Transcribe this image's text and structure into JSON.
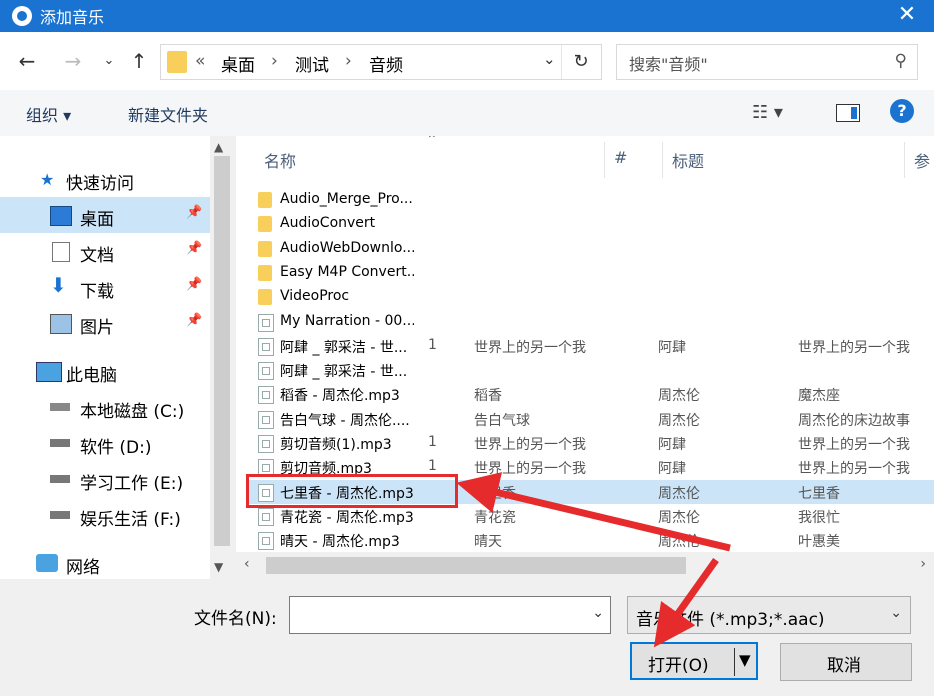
{
  "window": {
    "title": "添加音乐",
    "close_icon": "close-icon"
  },
  "nav": {
    "breadcrumb": [
      "桌面",
      "测试",
      "音频"
    ],
    "overflow": "«",
    "search_placeholder": "搜索\"音频\""
  },
  "toolbar": {
    "organize": "组织 ▾",
    "new_folder": "新建文件夹",
    "help": "?"
  },
  "sidebar": {
    "items": [
      {
        "label": "快速访问",
        "icon": "star-icon",
        "pinned": false
      },
      {
        "label": "桌面",
        "icon": "desktop-icon",
        "pinned": true
      },
      {
        "label": "文档",
        "icon": "document-icon",
        "pinned": true
      },
      {
        "label": "下载",
        "icon": "download-icon",
        "pinned": true
      },
      {
        "label": "图片",
        "icon": "pictures-icon",
        "pinned": true
      },
      {
        "label": "此电脑",
        "icon": "computer-icon",
        "pinned": false
      },
      {
        "label": "本地磁盘 (C:)",
        "icon": "drive-icon",
        "pinned": false
      },
      {
        "label": "软件 (D:)",
        "icon": "drive-icon",
        "pinned": false
      },
      {
        "label": "学习工作 (E:)",
        "icon": "drive-icon",
        "pinned": false
      },
      {
        "label": "娱乐生活 (F:)",
        "icon": "drive-icon",
        "pinned": false
      },
      {
        "label": "网络",
        "icon": "network-icon",
        "pinned": false
      }
    ],
    "selected_index": 1
  },
  "filelist": {
    "columns": [
      "名称",
      "#",
      "标题",
      "参"
    ],
    "rows": [
      {
        "name": "Audio_Merge_Pro...",
        "num": "",
        "title": "",
        "artist": "",
        "album": "",
        "kind": "folder"
      },
      {
        "name": "AudioConvert",
        "num": "",
        "title": "",
        "artist": "",
        "album": "",
        "kind": "folder"
      },
      {
        "name": "AudioWebDownlo...",
        "num": "",
        "title": "",
        "artist": "",
        "album": "",
        "kind": "folder"
      },
      {
        "name": "Easy M4P Convert...",
        "num": "",
        "title": "",
        "artist": "",
        "album": "",
        "kind": "folder"
      },
      {
        "name": "VideoProc",
        "num": "",
        "title": "",
        "artist": "",
        "album": "",
        "kind": "folder"
      },
      {
        "name": "My Narration - 00...",
        "num": "",
        "title": "",
        "artist": "",
        "album": "",
        "kind": "file"
      },
      {
        "name": "阿肆 _ 郭采洁 - 世...",
        "num": "1",
        "title": "世界上的另一个我",
        "artist": "阿肆",
        "album": "世界上的另一个我",
        "kind": "file"
      },
      {
        "name": "阿肆 _ 郭采洁 - 世...",
        "num": "",
        "title": "",
        "artist": "",
        "album": "",
        "kind": "file"
      },
      {
        "name": "稻香 - 周杰伦.mp3",
        "num": "",
        "title": "稻香",
        "artist": "周杰伦",
        "album": "魔杰座",
        "kind": "file"
      },
      {
        "name": "告白气球 - 周杰伦....",
        "num": "",
        "title": "告白气球",
        "artist": "周杰伦",
        "album": "周杰伦的床边故事",
        "kind": "file"
      },
      {
        "name": "剪切音频(1).mp3",
        "num": "1",
        "title": "世界上的另一个我",
        "artist": "阿肆",
        "album": "世界上的另一个我",
        "kind": "file"
      },
      {
        "name": "剪切音频.mp3",
        "num": "1",
        "title": "世界上的另一个我",
        "artist": "阿肆",
        "album": "世界上的另一个我",
        "kind": "file"
      },
      {
        "name": "七里香 - 周杰伦.mp3",
        "num": "",
        "title": "七里香",
        "artist": "周杰伦",
        "album": "七里香",
        "kind": "file"
      },
      {
        "name": "青花瓷 - 周杰伦.mp3",
        "num": "",
        "title": "青花瓷",
        "artist": "周杰伦",
        "album": "我很忙",
        "kind": "file"
      },
      {
        "name": "晴天 - 周杰伦.mp3",
        "num": "",
        "title": "晴天",
        "artist": "周杰伦",
        "album": "叶惠美",
        "kind": "file"
      }
    ],
    "selected_index": 12
  },
  "footer": {
    "filename_label": "文件名(N):",
    "filename_value": "",
    "filetype": "音乐文件 (*.mp3;*.aac)",
    "open_label": "打开(O)",
    "cancel_label": "取消"
  },
  "colors": {
    "accent": "#1a73d0",
    "selection": "#cce4f7",
    "annotation": "#e52b2b"
  }
}
